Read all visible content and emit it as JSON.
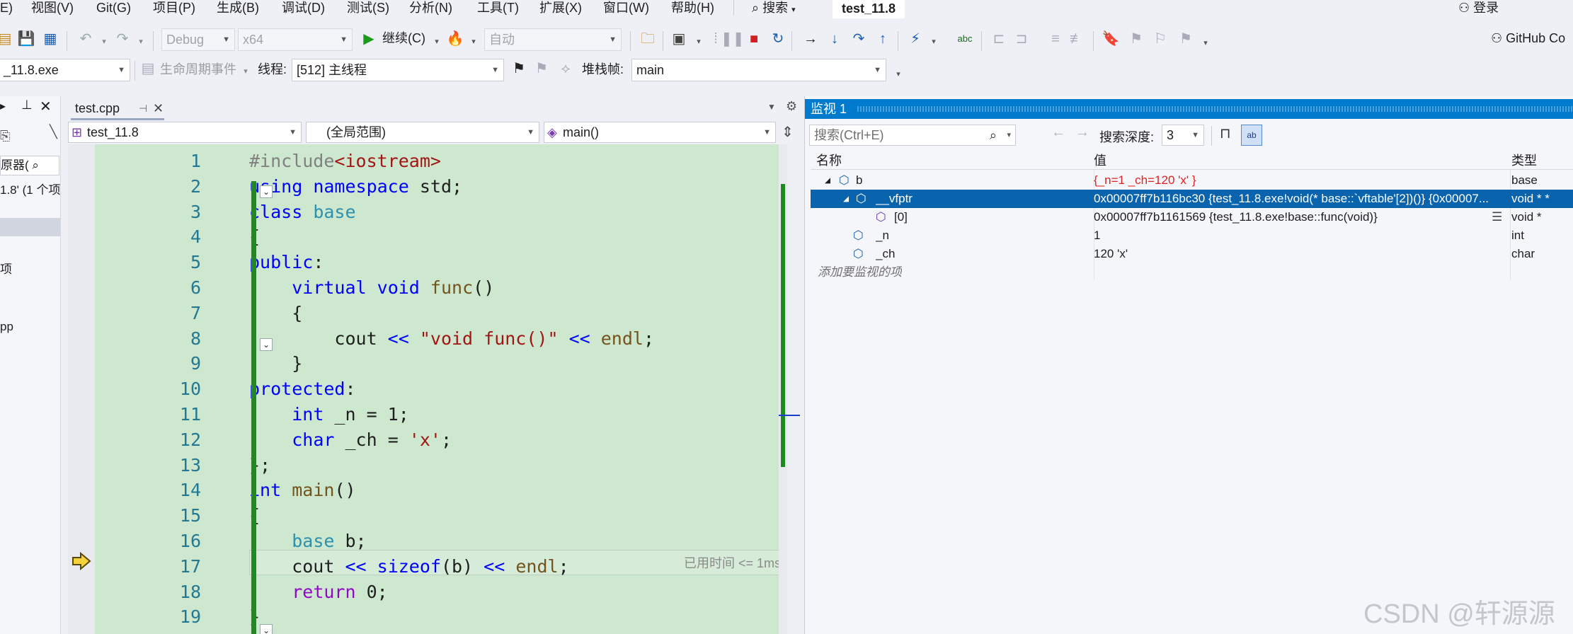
{
  "menu": {
    "items": [
      "E)",
      "视图(V)",
      "Git(G)",
      "项目(P)",
      "生成(B)",
      "调试(D)",
      "测试(S)",
      "分析(N)",
      "工具(T)",
      "扩展(X)",
      "窗口(W)",
      "帮助(H)"
    ],
    "search": "搜索",
    "solution_title": "test_11.8",
    "login": "登录"
  },
  "toolbar": {
    "config": "Debug",
    "platform": "x64",
    "continue_label": "继续(C)",
    "auto_combo": "自动",
    "github": "GitHub Co"
  },
  "debugbar": {
    "process": "_11.8.exe",
    "lifecycle": "生命周期事件",
    "thread_label": "线程:",
    "thread": "[512] 主线程",
    "stack_label": "堆栈帧:",
    "stack": "main"
  },
  "left_panel": {
    "t1": "原器(",
    "t2": "1.8' (1 个项",
    "t3": "项",
    "t4": "pp"
  },
  "editor": {
    "file_tab": "test.cpp",
    "nav_project": "test_11.8",
    "nav_scope": "(全局范围)",
    "nav_member": "main()",
    "hint": "已用时间 <= 1ms",
    "lines": [
      {
        "no": "1",
        "segs": [
          [
            "pp",
            "#include"
          ],
          [
            "inc",
            "<iostream>"
          ]
        ]
      },
      {
        "no": "2",
        "segs": [
          [
            "kw",
            "using"
          ],
          [
            "plain",
            " "
          ],
          [
            "kw",
            "namespace"
          ],
          [
            "plain",
            " std;"
          ]
        ]
      },
      {
        "no": "3",
        "segs": [
          [
            "kw",
            "class"
          ],
          [
            "plain",
            " "
          ],
          [
            "cls",
            "base"
          ]
        ]
      },
      {
        "no": "4",
        "segs": [
          [
            "plain",
            "{"
          ]
        ]
      },
      {
        "no": "5",
        "segs": [
          [
            "kw",
            "public"
          ],
          [
            "plain",
            ":"
          ]
        ]
      },
      {
        "no": "6",
        "segs": [
          [
            "plain",
            "    "
          ],
          [
            "kw",
            "virtual"
          ],
          [
            "plain",
            " "
          ],
          [
            "kw",
            "void"
          ],
          [
            "plain",
            " "
          ],
          [
            "fn",
            "func"
          ],
          [
            "plain",
            "()"
          ]
        ]
      },
      {
        "no": "7",
        "segs": [
          [
            "plain",
            "    {"
          ]
        ]
      },
      {
        "no": "8",
        "segs": [
          [
            "plain",
            "        cout "
          ],
          [
            "kw",
            "<<"
          ],
          [
            "plain",
            " "
          ],
          [
            "str",
            "\"void func()\""
          ],
          [
            "plain",
            " "
          ],
          [
            "kw",
            "<<"
          ],
          [
            "plain",
            " "
          ],
          [
            "fn",
            "endl"
          ],
          [
            "plain",
            ";"
          ]
        ]
      },
      {
        "no": "9",
        "segs": [
          [
            "plain",
            "    }"
          ]
        ]
      },
      {
        "no": "10",
        "segs": [
          [
            "kw",
            "protected"
          ],
          [
            "plain",
            ":"
          ]
        ]
      },
      {
        "no": "11",
        "segs": [
          [
            "plain",
            "    "
          ],
          [
            "kw",
            "int"
          ],
          [
            "plain",
            " _n = 1;"
          ]
        ]
      },
      {
        "no": "12",
        "segs": [
          [
            "plain",
            "    "
          ],
          [
            "kw",
            "char"
          ],
          [
            "plain",
            " _ch = "
          ],
          [
            "str",
            "'x'"
          ],
          [
            "plain",
            ";"
          ]
        ]
      },
      {
        "no": "13",
        "segs": [
          [
            "plain",
            "};"
          ]
        ]
      },
      {
        "no": "14",
        "segs": [
          [
            "kw",
            "int"
          ],
          [
            "plain",
            " "
          ],
          [
            "fn",
            "main"
          ],
          [
            "plain",
            "()"
          ]
        ]
      },
      {
        "no": "15",
        "segs": [
          [
            "plain",
            "{"
          ]
        ]
      },
      {
        "no": "16",
        "segs": [
          [
            "plain",
            "    "
          ],
          [
            "cls",
            "base"
          ],
          [
            "plain",
            " b;"
          ]
        ]
      },
      {
        "no": "17",
        "segs": [
          [
            "plain",
            "    cout "
          ],
          [
            "kw",
            "<<"
          ],
          [
            "plain",
            " "
          ],
          [
            "kw",
            "sizeof"
          ],
          [
            "plain",
            "(b) "
          ],
          [
            "kw",
            "<<"
          ],
          [
            "plain",
            " "
          ],
          [
            "fn",
            "endl"
          ],
          [
            "plain",
            ";"
          ]
        ]
      },
      {
        "no": "18",
        "segs": [
          [
            "plain",
            "    "
          ],
          [
            "kwp",
            "return"
          ],
          [
            "plain",
            " 0;"
          ]
        ]
      },
      {
        "no": "19",
        "segs": [
          [
            "plain",
            "}"
          ]
        ]
      }
    ]
  },
  "watch": {
    "title": "监视 1",
    "search_placeholder": "搜索(Ctrl+E)",
    "depth_label": "搜索深度:",
    "depth": "3",
    "col_name": "名称",
    "col_value": "值",
    "col_type": "类型",
    "rows": [
      {
        "name": "b",
        "value": "{_n=1 _ch=120 'x' }",
        "type": "base"
      },
      {
        "name": "__vfptr",
        "value": "0x00007ff7b116bc30 {test_11.8.exe!void(* base::`vftable'[2])()} {0x00007...",
        "type": "void * *"
      },
      {
        "name": "[0]",
        "value": "0x00007ff7b1161569 {test_11.8.exe!base::func(void)}",
        "type": "void *"
      },
      {
        "name": "_n",
        "value": "1",
        "type": "int"
      },
      {
        "name": "_ch",
        "value": "120 'x'",
        "type": "char"
      }
    ],
    "add_item": "添加要监视的项"
  },
  "watermark": "CSDN @轩源源",
  "colors": {
    "accent": "#007acc",
    "selection": "#0a64ad",
    "code_bg": "#cde8cf",
    "change_bar": "#1f8a1f"
  }
}
